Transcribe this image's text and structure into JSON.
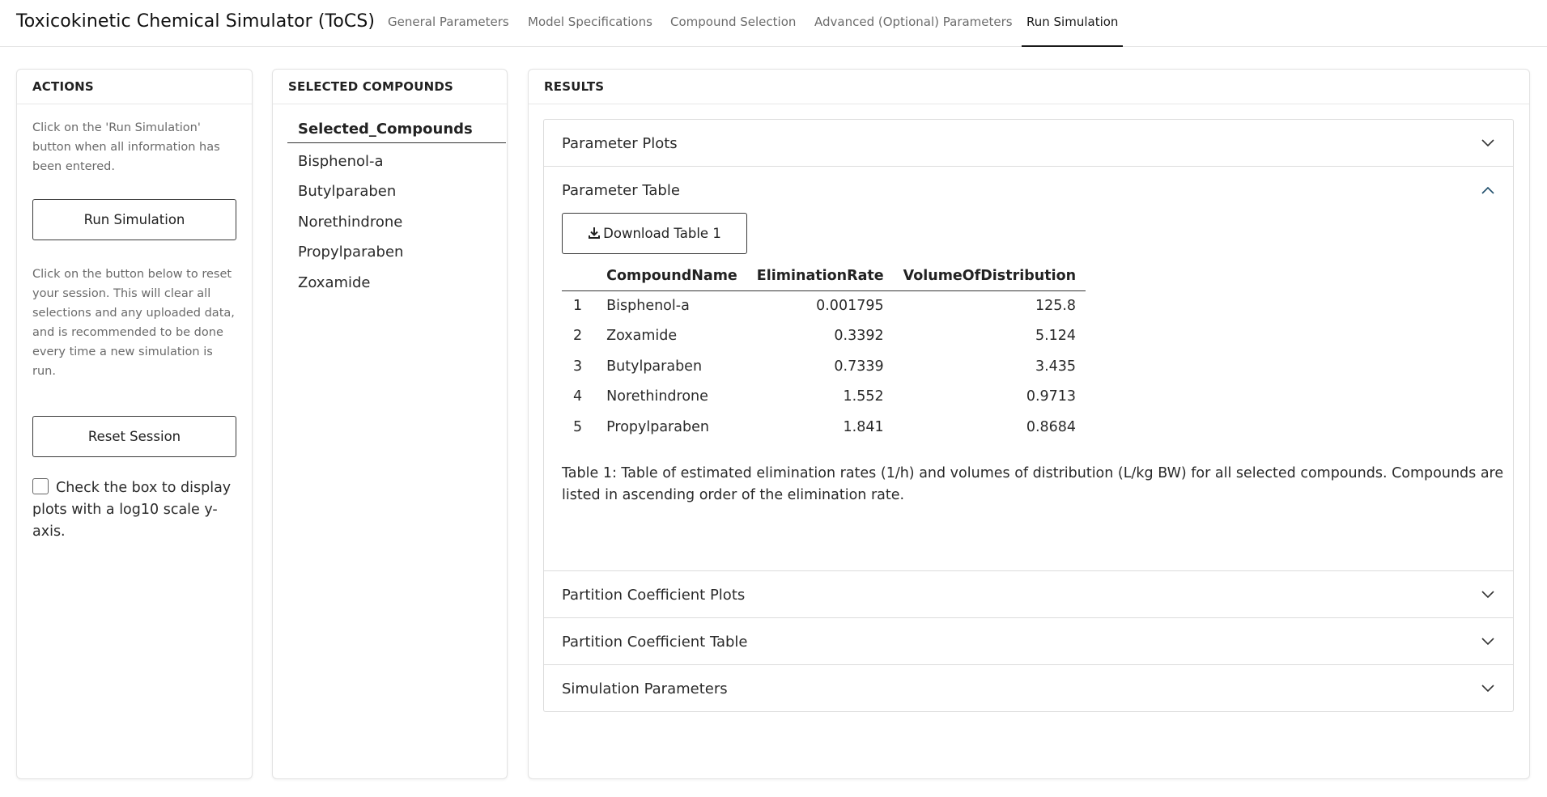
{
  "app": {
    "title": "Toxicokinetic Chemical Simulator (ToCS)"
  },
  "nav": {
    "tabs": [
      {
        "label": "General Parameters"
      },
      {
        "label": "Model Specifications"
      },
      {
        "label": "Compound Selection"
      },
      {
        "label": "Advanced (Optional) Parameters"
      },
      {
        "label": "Run Simulation",
        "active": true
      }
    ]
  },
  "actions": {
    "header": "ACTIONS",
    "run_help": "Click on the 'Run Simulation' button when all information has been entered.",
    "run_label": "Run Simulation",
    "reset_help": "Click on the button below to reset your session. This will clear all selections and any uploaded data, and is recommended to be done every time a new simulation is run.",
    "reset_label": "Reset Session",
    "log_checkbox_label": "Check the box to display plots with a log10 scale y-axis.",
    "log_checkbox_checked": false
  },
  "selected": {
    "header": "SELECTED COMPOUNDS",
    "column_header": "Selected_Compounds",
    "items": [
      "Bisphenol-a",
      "Butylparaben",
      "Norethindrone",
      "Propylparaben",
      "Zoxamide"
    ]
  },
  "results": {
    "header": "RESULTS",
    "sections": [
      {
        "label": "Parameter Plots",
        "expanded": false
      },
      {
        "label": "Parameter Table",
        "expanded": true
      },
      {
        "label": "Partition Coefficient Plots",
        "expanded": false
      },
      {
        "label": "Partition Coefficient Table",
        "expanded": false
      },
      {
        "label": "Simulation Parameters",
        "expanded": false
      }
    ],
    "download_label": "Download Table 1",
    "table": {
      "columns": [
        "CompoundName",
        "EliminationRate",
        "VolumeOfDistribution"
      ],
      "rows": [
        {
          "idx": "1",
          "name": "Bisphenol-a",
          "rate": "0.001795",
          "vd": "125.8"
        },
        {
          "idx": "2",
          "name": "Zoxamide",
          "rate": "0.3392",
          "vd": "5.124"
        },
        {
          "idx": "3",
          "name": "Butylparaben",
          "rate": "0.7339",
          "vd": "3.435"
        },
        {
          "idx": "4",
          "name": "Norethindrone",
          "rate": "1.552",
          "vd": "0.9713"
        },
        {
          "idx": "5",
          "name": "Propylparaben",
          "rate": "1.841",
          "vd": "0.8684"
        }
      ]
    },
    "caption": "Table 1: Table of estimated elimination rates (1/h) and volumes of distribution (L/kg BW) for all selected compounds. Compounds are listed in ascending order of the elimination rate."
  }
}
